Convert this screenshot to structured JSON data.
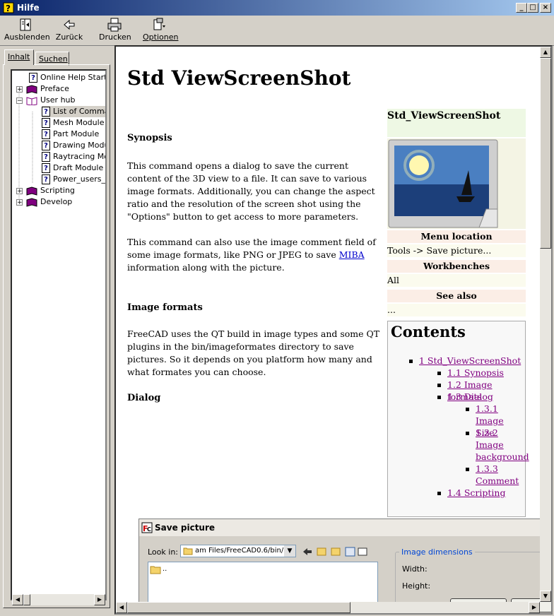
{
  "window": {
    "title": "Hilfe",
    "min": "_",
    "max": "□",
    "close": "×"
  },
  "toolbar": {
    "hide_label": "Ausblenden",
    "back_label": "Zurück",
    "print_label": "Drucken",
    "options_label": "Optionen"
  },
  "nav": {
    "tab_contents": "Inhalt",
    "tab_search": "Suchen",
    "tree": [
      {
        "label": "Online Help Startpa",
        "kind": "page"
      },
      {
        "label": "Preface",
        "kind": "book"
      },
      {
        "label": "User hub",
        "kind": "book-open"
      },
      {
        "label": "List of Comman",
        "kind": "page",
        "selected": true
      },
      {
        "label": "Mesh Module",
        "kind": "page"
      },
      {
        "label": "Part Module",
        "kind": "page"
      },
      {
        "label": "Drawing Modu",
        "kind": "page"
      },
      {
        "label": "Raytracing Mo",
        "kind": "page"
      },
      {
        "label": "Draft Module",
        "kind": "page"
      },
      {
        "label": "Power_users_l",
        "kind": "page"
      },
      {
        "label": "Scripting",
        "kind": "book"
      },
      {
        "label": "Develop",
        "kind": "book"
      }
    ]
  },
  "article": {
    "title": "Std ViewScreenShot",
    "synopsis_heading": "Synopsis",
    "synopsis_p1": "This command opens a dialog to save the current content of the 3D view to a file. It can save to various image formats. Additionally, you can change the aspect ratio and the resolution of the screen shot using the \"Options\" button to get access to more parameters.",
    "synopsis_p2_pre": "This command can also use the image comment field of some image formats, like PNG or JPEG to save ",
    "synopsis_p2_link": "MIBA",
    "synopsis_p2_post": " information along with the picture.",
    "formats_heading": "Image formats",
    "formats_p": "FreeCAD uses the QT build in image types and some QT plugins in the bin/imageformates directory to save pictures. So it depends on you platform how many and what formates you can choose.",
    "dialog_heading": "Dialog"
  },
  "infobox": {
    "title": "Std_ViewScreenShot",
    "menu_location_label": "Menu location",
    "menu_location_value": "Tools -> Save picture...",
    "workbenches_label": "Workbenches",
    "workbenches_value": "All",
    "see_also_label": "See also",
    "see_also_value": "..."
  },
  "toc": {
    "title": "Contents",
    "items": [
      "1 Std_ViewScreenShot",
      "1.1 Synopsis",
      "1.2 Image formats",
      "1.3 Dialog",
      "1.3.1 Image Size",
      "1.3.2 Image background",
      "1.3.3 Comment",
      "1.4 Scripting"
    ]
  },
  "save_dialog": {
    "title": "Save picture",
    "look_in_label": "Look in:",
    "look_in_value": "am Files/FreeCAD0.6/bin/",
    "folder_item": "..",
    "group_label": "Image dimensions",
    "width_label": "Width:",
    "height_label": "Height:"
  }
}
